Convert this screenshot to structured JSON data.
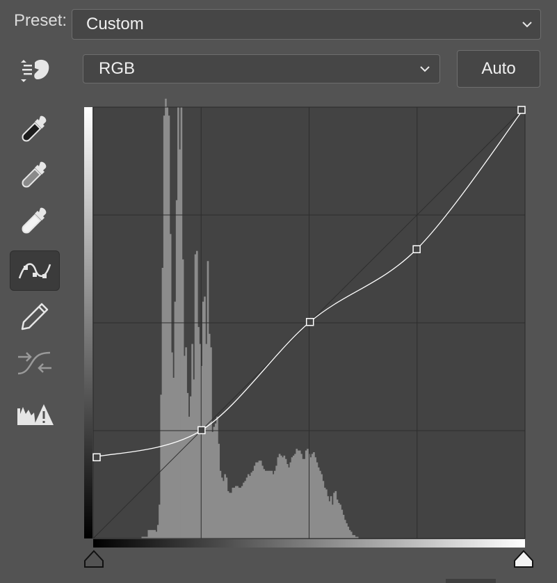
{
  "preset": {
    "label": "Preset:",
    "value": "Custom"
  },
  "channel": {
    "value": "RGB"
  },
  "auto_label": "Auto",
  "tools": [
    {
      "name": "on-image-adjust-icon"
    },
    {
      "name": "black-point-eyedropper-icon"
    },
    {
      "name": "gray-point-eyedropper-icon"
    },
    {
      "name": "white-point-eyedropper-icon"
    },
    {
      "name": "curve-points-icon",
      "active": true
    },
    {
      "name": "pencil-icon"
    },
    {
      "name": "smooth-curve-icon"
    },
    {
      "name": "clipping-warning-icon"
    }
  ],
  "curve": {
    "input_range": [
      0,
      255
    ],
    "output_range": [
      0,
      255
    ],
    "control_points": [
      [
        0,
        48
      ],
      [
        64,
        64
      ],
      [
        128,
        128
      ],
      [
        191,
        171
      ],
      [
        255,
        255
      ]
    ]
  },
  "histogram": {
    "bins": [
      0,
      0,
      0,
      0,
      0,
      0,
      0,
      0,
      0,
      0,
      0,
      0,
      0,
      0,
      0,
      0,
      0,
      0,
      0,
      0,
      0,
      0,
      0,
      0,
      0,
      0,
      0,
      0,
      0,
      0,
      0,
      1,
      1,
      1,
      1,
      5,
      5,
      5,
      5,
      5,
      4,
      8,
      20,
      85,
      160,
      250,
      260,
      255,
      250,
      180,
      110,
      95,
      140,
      200,
      255,
      230,
      255,
      165,
      108,
      113,
      86,
      72,
      84,
      115,
      94,
      168,
      170,
      125,
      115,
      102,
      140,
      143,
      115,
      164,
      121,
      113,
      63,
      66,
      68,
      72,
      56,
      40,
      36,
      34,
      38,
      36,
      28,
      27,
      27,
      30,
      30,
      31,
      31,
      30,
      30,
      31,
      33,
      34,
      36,
      38,
      37,
      39,
      40,
      43,
      45,
      45,
      46,
      46,
      43,
      41,
      40,
      40,
      40,
      40,
      40,
      38,
      40,
      43,
      48,
      50,
      49,
      48,
      49,
      47,
      44,
      42,
      45,
      48,
      49,
      50,
      53,
      52,
      52,
      50,
      47,
      47,
      52,
      53,
      50,
      48,
      50,
      51,
      48,
      45,
      42,
      40,
      38,
      34,
      30,
      29,
      25,
      22,
      25,
      20,
      27,
      28,
      23,
      21,
      20,
      17,
      14,
      11,
      9,
      7,
      5,
      4,
      2,
      2,
      1,
      1,
      0,
      0,
      0,
      0,
      0,
      0,
      0,
      0,
      0,
      0,
      0,
      0,
      0,
      0,
      0,
      0,
      0,
      0,
      0,
      0,
      0,
      0,
      0,
      0,
      0,
      0,
      0,
      0,
      0,
      0,
      0,
      0,
      0,
      0,
      0,
      0,
      0,
      0,
      0,
      0,
      0,
      0,
      0,
      0,
      0,
      0,
      0,
      0,
      0,
      0,
      0,
      0,
      0,
      0,
      0,
      0,
      0,
      0,
      0,
      0,
      0,
      0,
      0,
      0,
      0,
      0,
      0,
      0,
      0,
      0,
      0,
      0,
      0,
      0,
      0,
      0,
      0,
      0,
      0,
      0,
      0,
      0,
      0,
      0,
      0,
      0,
      0,
      0,
      0,
      0,
      0,
      0,
      0,
      0,
      0,
      0,
      0,
      0,
      0,
      0,
      0,
      0,
      0,
      0,
      0,
      0,
      0
    ],
    "max": 255
  },
  "colors": {
    "panel": "#535353",
    "graph_bg": "#434343",
    "histogram": "#8c8c8c",
    "grid": "#2d2d2d",
    "curve": "#ffffff"
  }
}
